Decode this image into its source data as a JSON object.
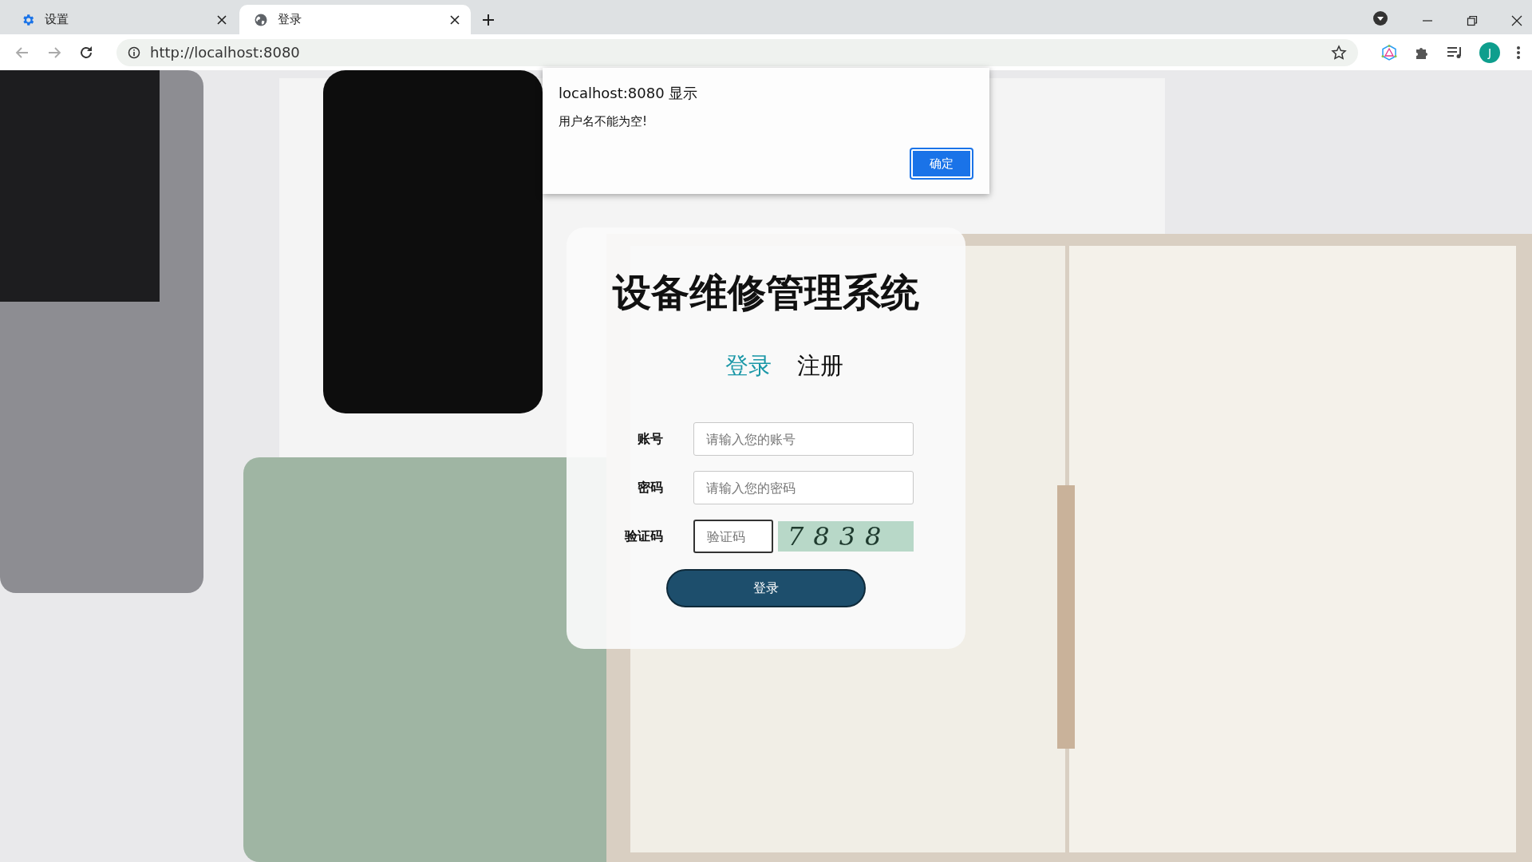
{
  "browser": {
    "tabs": [
      {
        "title": "设置",
        "kind": "settings",
        "selected": false
      },
      {
        "title": "登录",
        "kind": "web",
        "selected": true
      }
    ],
    "address": "http://localhost:8080",
    "avatar": "J"
  },
  "dialog": {
    "title": "localhost:8080 显示",
    "message": "用户名不能为空!",
    "button": "确定"
  },
  "login": {
    "title": "设备维修管理系统",
    "tabs": [
      {
        "label": "登录",
        "selected": true
      },
      {
        "label": "注册",
        "selected": false
      }
    ],
    "fields": [
      {
        "label": "账号",
        "placeholder": "请输入您的账号",
        "kind": "text"
      },
      {
        "label": "密码",
        "placeholder": "请输入您的密码",
        "kind": "password"
      },
      {
        "label": "验证码",
        "placeholder": "验证码",
        "kind": "captcha",
        "captcha": "7838"
      }
    ],
    "submit": "登录"
  }
}
